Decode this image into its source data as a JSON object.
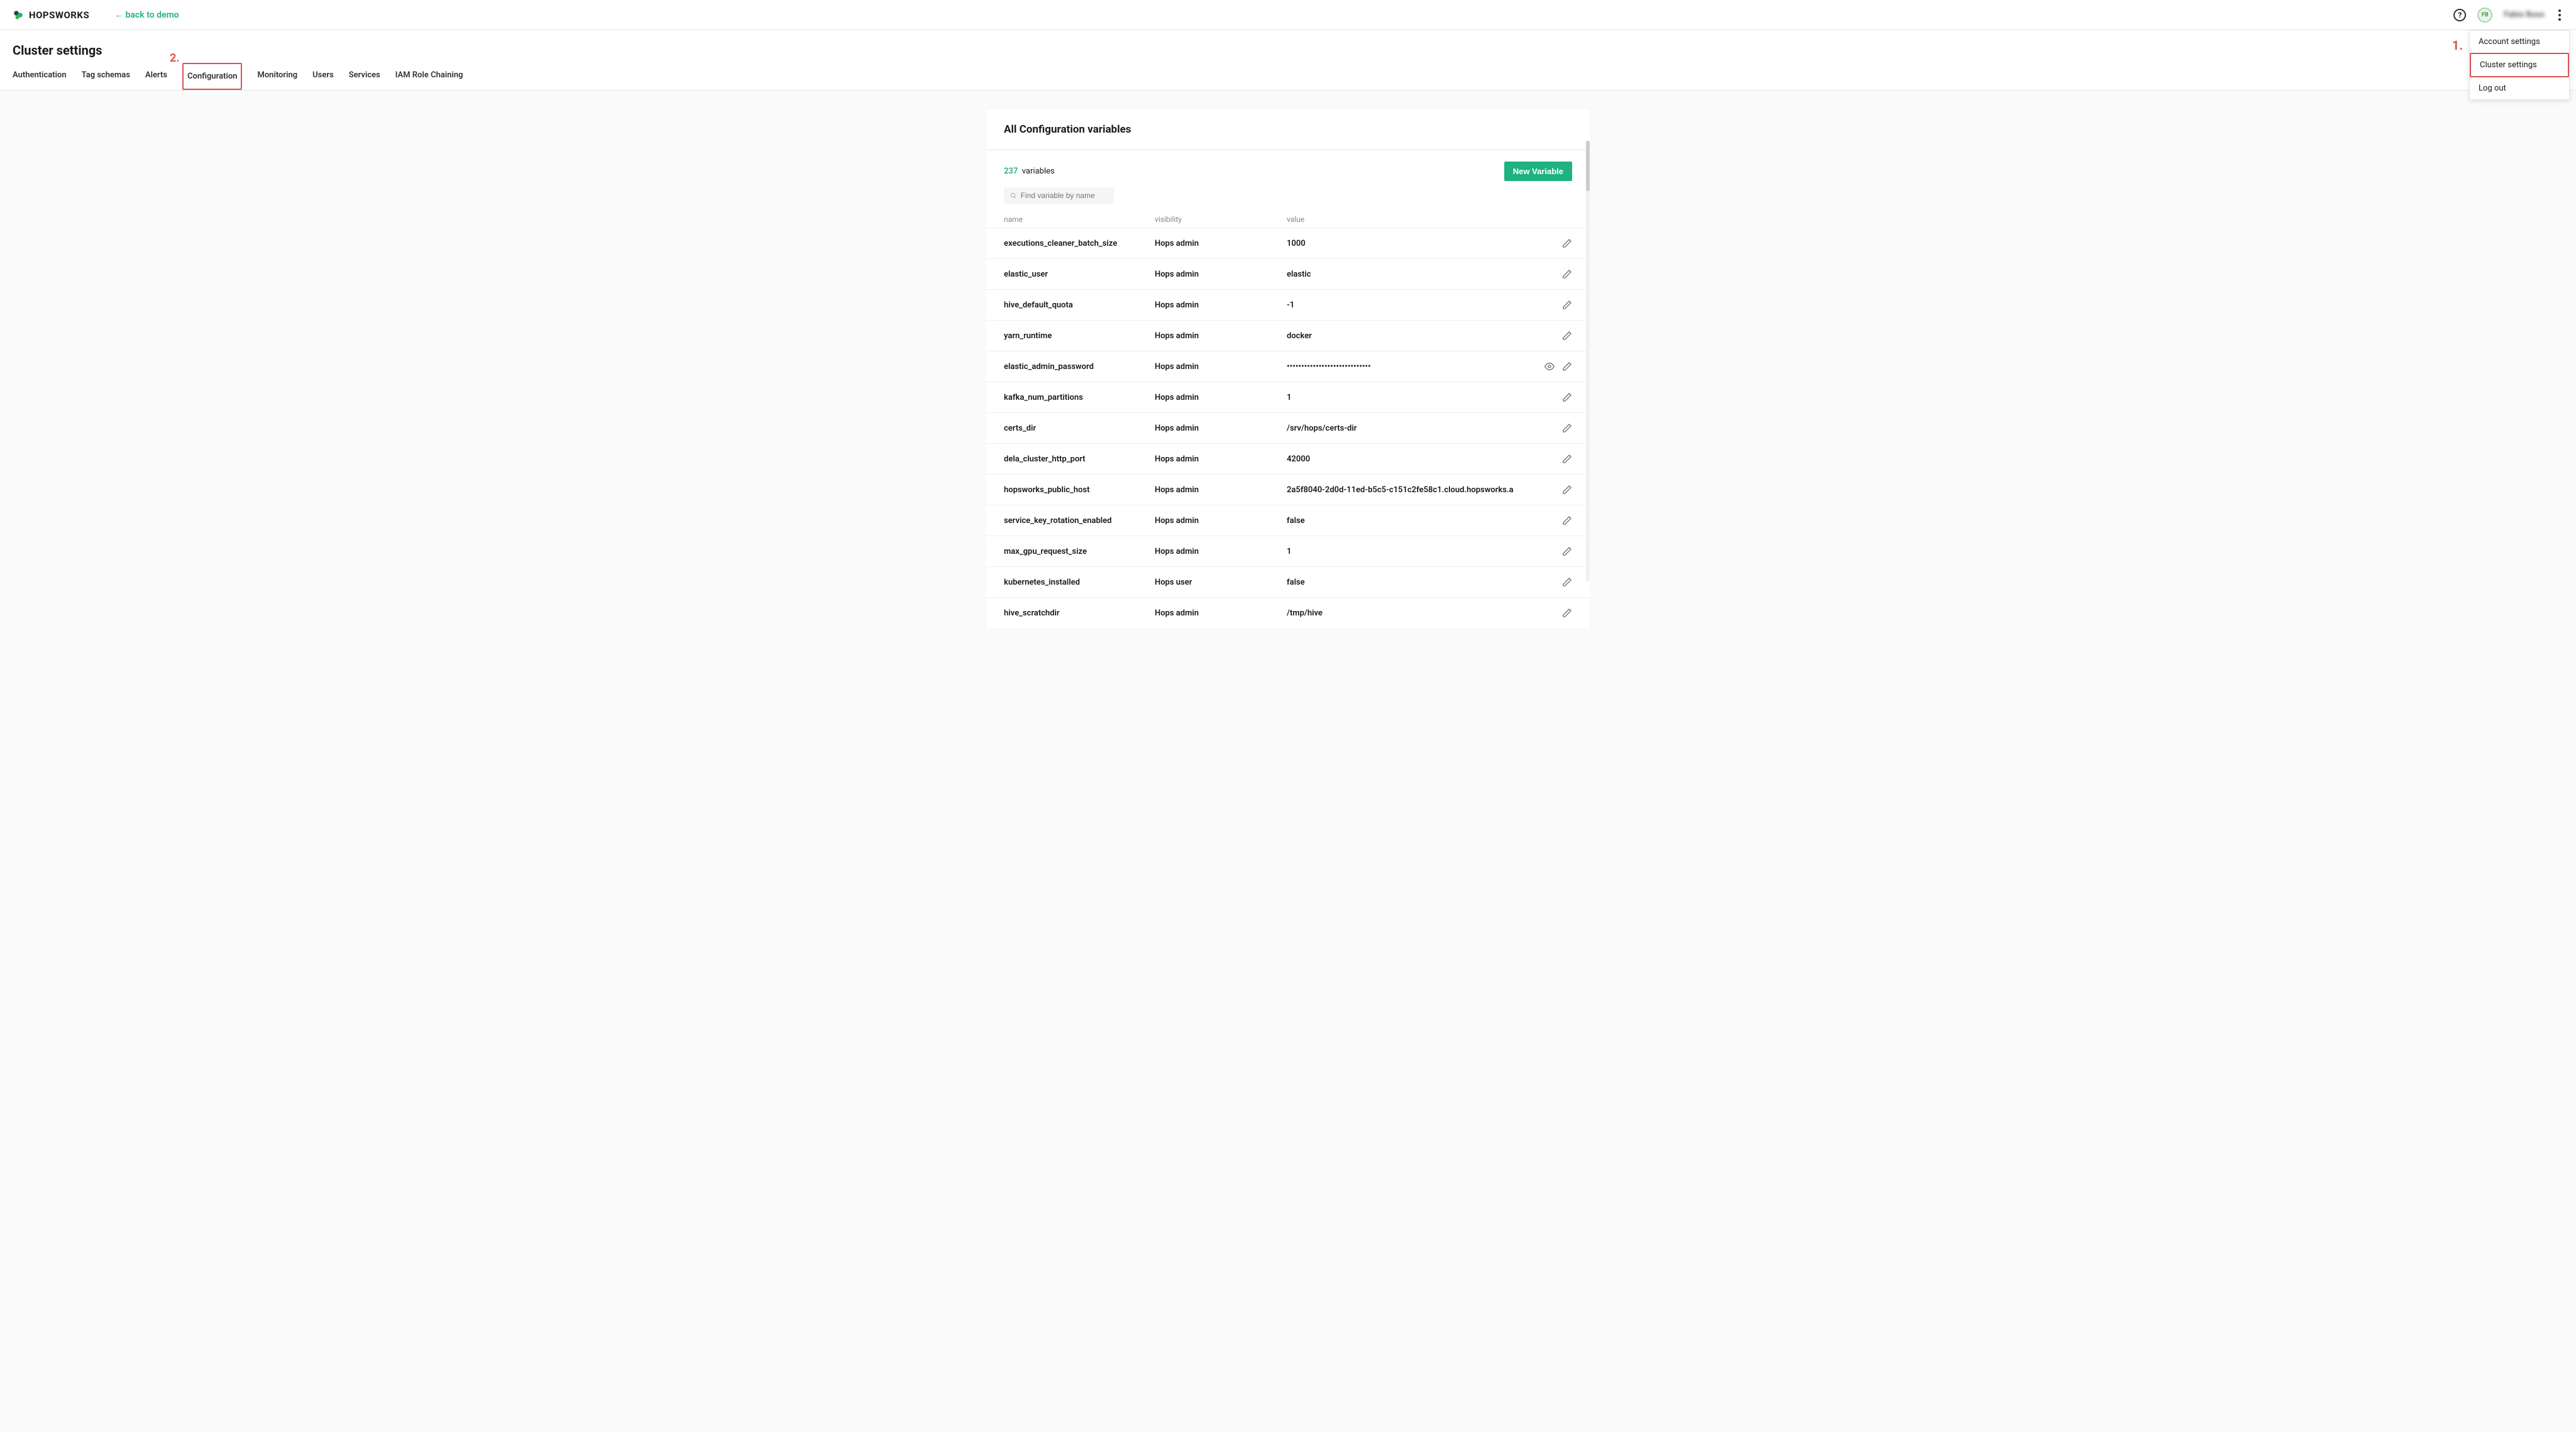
{
  "topbar": {
    "brand": "HOPSWORKS",
    "back_link": "← back to demo",
    "avatar_initials": "FB",
    "username": "Fabio Buso"
  },
  "dropdown": {
    "items": [
      {
        "label": "Account settings",
        "highlighted": false
      },
      {
        "label": "Cluster settings",
        "highlighted": true
      },
      {
        "label": "Log out",
        "highlighted": false
      }
    ]
  },
  "annotations": {
    "one": "1.",
    "two": "2."
  },
  "page": {
    "title": "Cluster settings"
  },
  "tabs": [
    {
      "label": "Authentication",
      "active": false,
      "boxed": false
    },
    {
      "label": "Tag schemas",
      "active": false,
      "boxed": false
    },
    {
      "label": "Alerts",
      "active": false,
      "boxed": false
    },
    {
      "label": "Configuration",
      "active": true,
      "boxed": true
    },
    {
      "label": "Monitoring",
      "active": false,
      "boxed": false
    },
    {
      "label": "Users",
      "active": false,
      "boxed": false
    },
    {
      "label": "Services",
      "active": false,
      "boxed": false
    },
    {
      "label": "IAM Role Chaining",
      "active": false,
      "boxed": false
    }
  ],
  "panel": {
    "title": "All Configuration variables",
    "count": "237",
    "count_label": "variables",
    "new_variable_btn": "New Variable",
    "search_placeholder": "Find variable by name",
    "columns": {
      "name": "name",
      "visibility": "visibility",
      "value": "value"
    }
  },
  "variables": [
    {
      "name": "executions_cleaner_batch_size",
      "visibility": "Hops admin",
      "value": "1000",
      "masked": false
    },
    {
      "name": "elastic_user",
      "visibility": "Hops admin",
      "value": "elastic",
      "masked": false
    },
    {
      "name": "hive_default_quota",
      "visibility": "Hops admin",
      "value": "-1",
      "masked": false
    },
    {
      "name": "yarn_runtime",
      "visibility": "Hops admin",
      "value": "docker",
      "masked": false
    },
    {
      "name": "elastic_admin_password",
      "visibility": "Hops admin",
      "value": "•••••••••••••••••••••••••••••",
      "masked": true
    },
    {
      "name": "kafka_num_partitions",
      "visibility": "Hops admin",
      "value": "1",
      "masked": false
    },
    {
      "name": "certs_dir",
      "visibility": "Hops admin",
      "value": "/srv/hops/certs-dir",
      "masked": false
    },
    {
      "name": "dela_cluster_http_port",
      "visibility": "Hops admin",
      "value": "42000",
      "masked": false
    },
    {
      "name": "hopsworks_public_host",
      "visibility": "Hops admin",
      "value": "2a5f8040-2d0d-11ed-b5c5-c151c2fe58c1.cloud.hopsworks.a",
      "masked": false
    },
    {
      "name": "service_key_rotation_enabled",
      "visibility": "Hops admin",
      "value": "false",
      "masked": false
    },
    {
      "name": "max_gpu_request_size",
      "visibility": "Hops admin",
      "value": "1",
      "masked": false
    },
    {
      "name": "kubernetes_installed",
      "visibility": "Hops user",
      "value": "false",
      "masked": false
    },
    {
      "name": "hive_scratchdir",
      "visibility": "Hops admin",
      "value": "/tmp/hive",
      "masked": false
    }
  ]
}
